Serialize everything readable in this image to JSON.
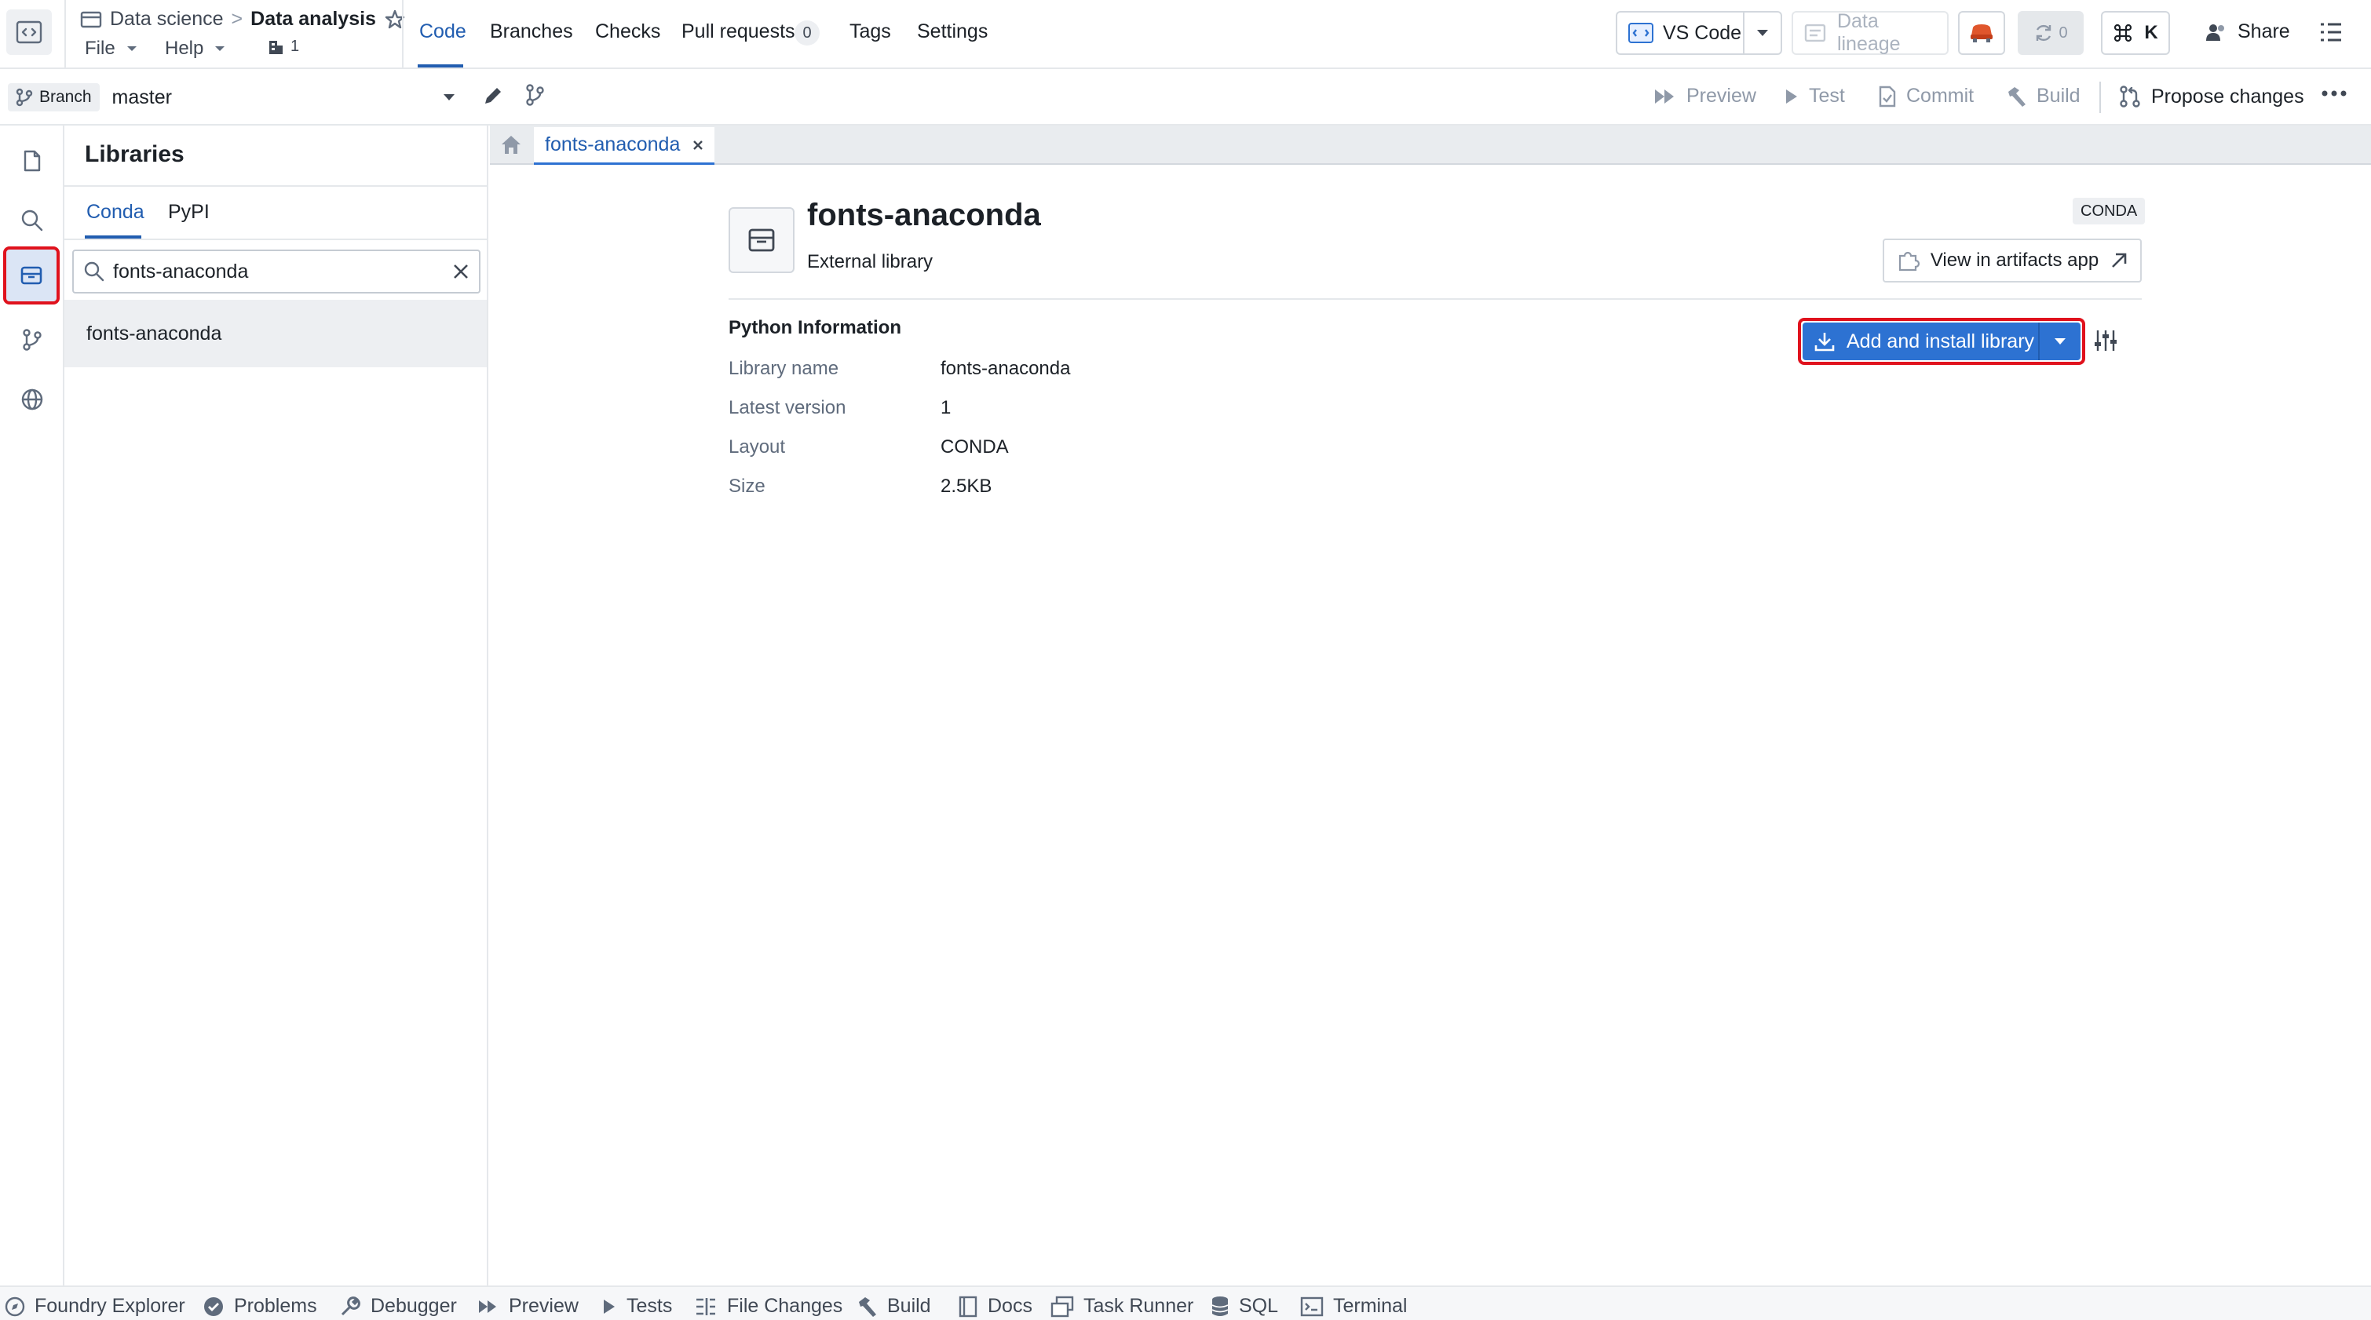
{
  "header": {
    "breadcrumb_parent": "Data science",
    "breadcrumb_sep": ">",
    "repo_title": "Data analysis",
    "menu_file": "File",
    "menu_help": "Help",
    "branch_count": "1",
    "tabs": [
      {
        "label": "Code",
        "active": true
      },
      {
        "label": "Branches"
      },
      {
        "label": "Checks"
      },
      {
        "label": "Pull requests"
      },
      {
        "label": "Tags"
      },
      {
        "label": "Settings"
      }
    ],
    "pull_requests_count": "0",
    "vscode_label": "VS Code",
    "data_lineage_label": "Data lineage",
    "sync_count": "0",
    "command_key": "K",
    "share_label": "Share"
  },
  "branchbar": {
    "branch_tag": "Branch",
    "branch_name": "master",
    "preview_label": "Preview",
    "test_label": "Test",
    "commit_label": "Commit",
    "build_label": "Build",
    "propose_label": "Propose changes"
  },
  "libraries": {
    "title": "Libraries",
    "tabs": [
      "Conda",
      "PyPI"
    ],
    "search_value": "fonts-anaconda",
    "results": [
      "fonts-anaconda"
    ]
  },
  "editor": {
    "open_tab": "fonts-anaconda",
    "library_name": "fonts-anaconda",
    "library_type": "External library",
    "badge": "CONDA",
    "view_artifacts_label": "View in artifacts app",
    "add_install_label": "Add and install library",
    "section_title": "Python Information",
    "info": [
      {
        "label": "Library name",
        "value": "fonts-anaconda"
      },
      {
        "label": "Latest version",
        "value": "1"
      },
      {
        "label": "Layout",
        "value": "CONDA"
      },
      {
        "label": "Size",
        "value": "2.5KB"
      }
    ]
  },
  "bottombar": {
    "items": [
      "Foundry Explorer",
      "Problems",
      "Debugger",
      "Preview",
      "Tests",
      "File Changes",
      "Build",
      "Docs",
      "Task Runner",
      "SQL",
      "Terminal"
    ]
  },
  "colors": {
    "accent_blue": "#2d72d2",
    "highlight_red": "#e0121d",
    "active_tab": "#215db0"
  }
}
